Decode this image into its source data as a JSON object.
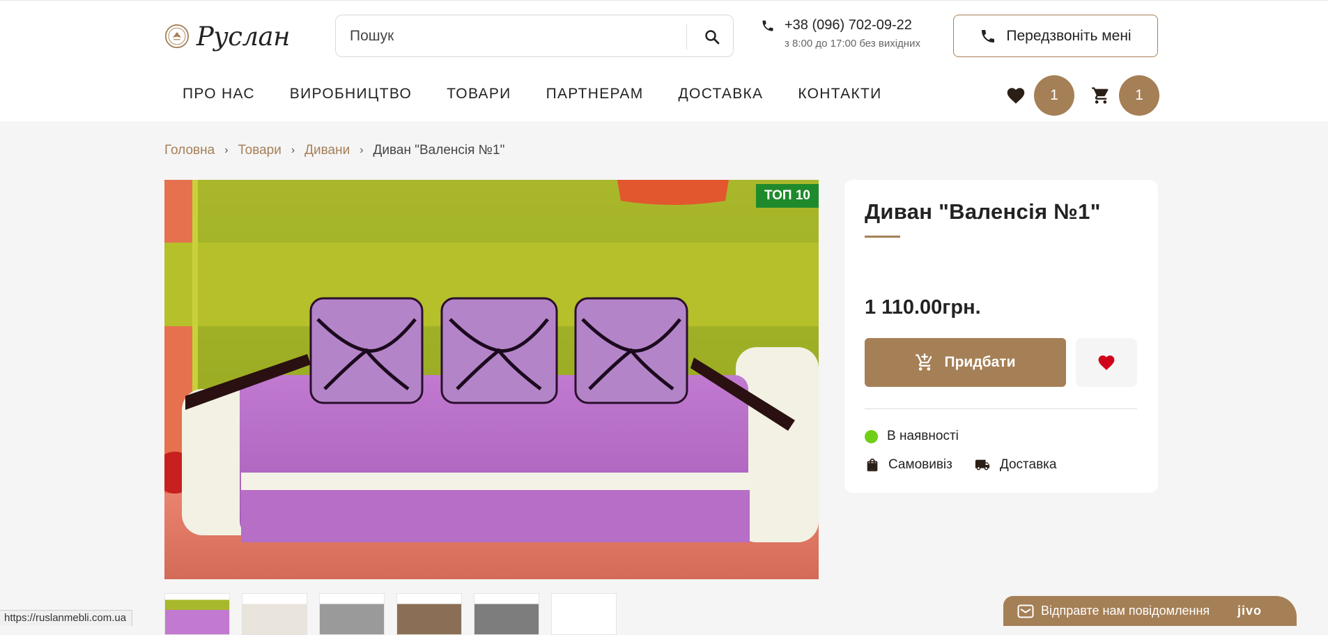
{
  "header": {
    "logo_text": "Руслан",
    "search_placeholder": "Пошук",
    "phone": "+38 (096) 702-09-22",
    "hours": "з 8:00 до 17:00 без вихідних",
    "callback_label": "Передзвоніть мені",
    "nav": [
      "ПРО НАС",
      "ВИРОБНИЦТВО",
      "ТОВАРИ",
      "ПАРТНЕРАМ",
      "ДОСТАВКА",
      "КОНТАКТИ"
    ],
    "favorites_count": "1",
    "cart_count": "1"
  },
  "breadcrumbs": {
    "home": "Головна",
    "products": "Товари",
    "category": "Дивани",
    "current": "Диван \"Валенсія №1\""
  },
  "product": {
    "badge": "ТОП 10",
    "title": "Диван \"Валенсія №1\"",
    "price": "1 110.00грн.",
    "buy_label": "Придбати",
    "stock_label": "В наявності",
    "pickup_label": "Самовивіз",
    "delivery_label": "Доставка"
  },
  "status_url": "https://ruslanmebli.com.ua",
  "chat": {
    "label": "Відправте нам повідомлення",
    "brand": "jivo"
  },
  "colors": {
    "accent": "#a57f56",
    "badge": "#1f8a2c",
    "in_stock": "#6fcf17",
    "heart": "#d0021b"
  }
}
